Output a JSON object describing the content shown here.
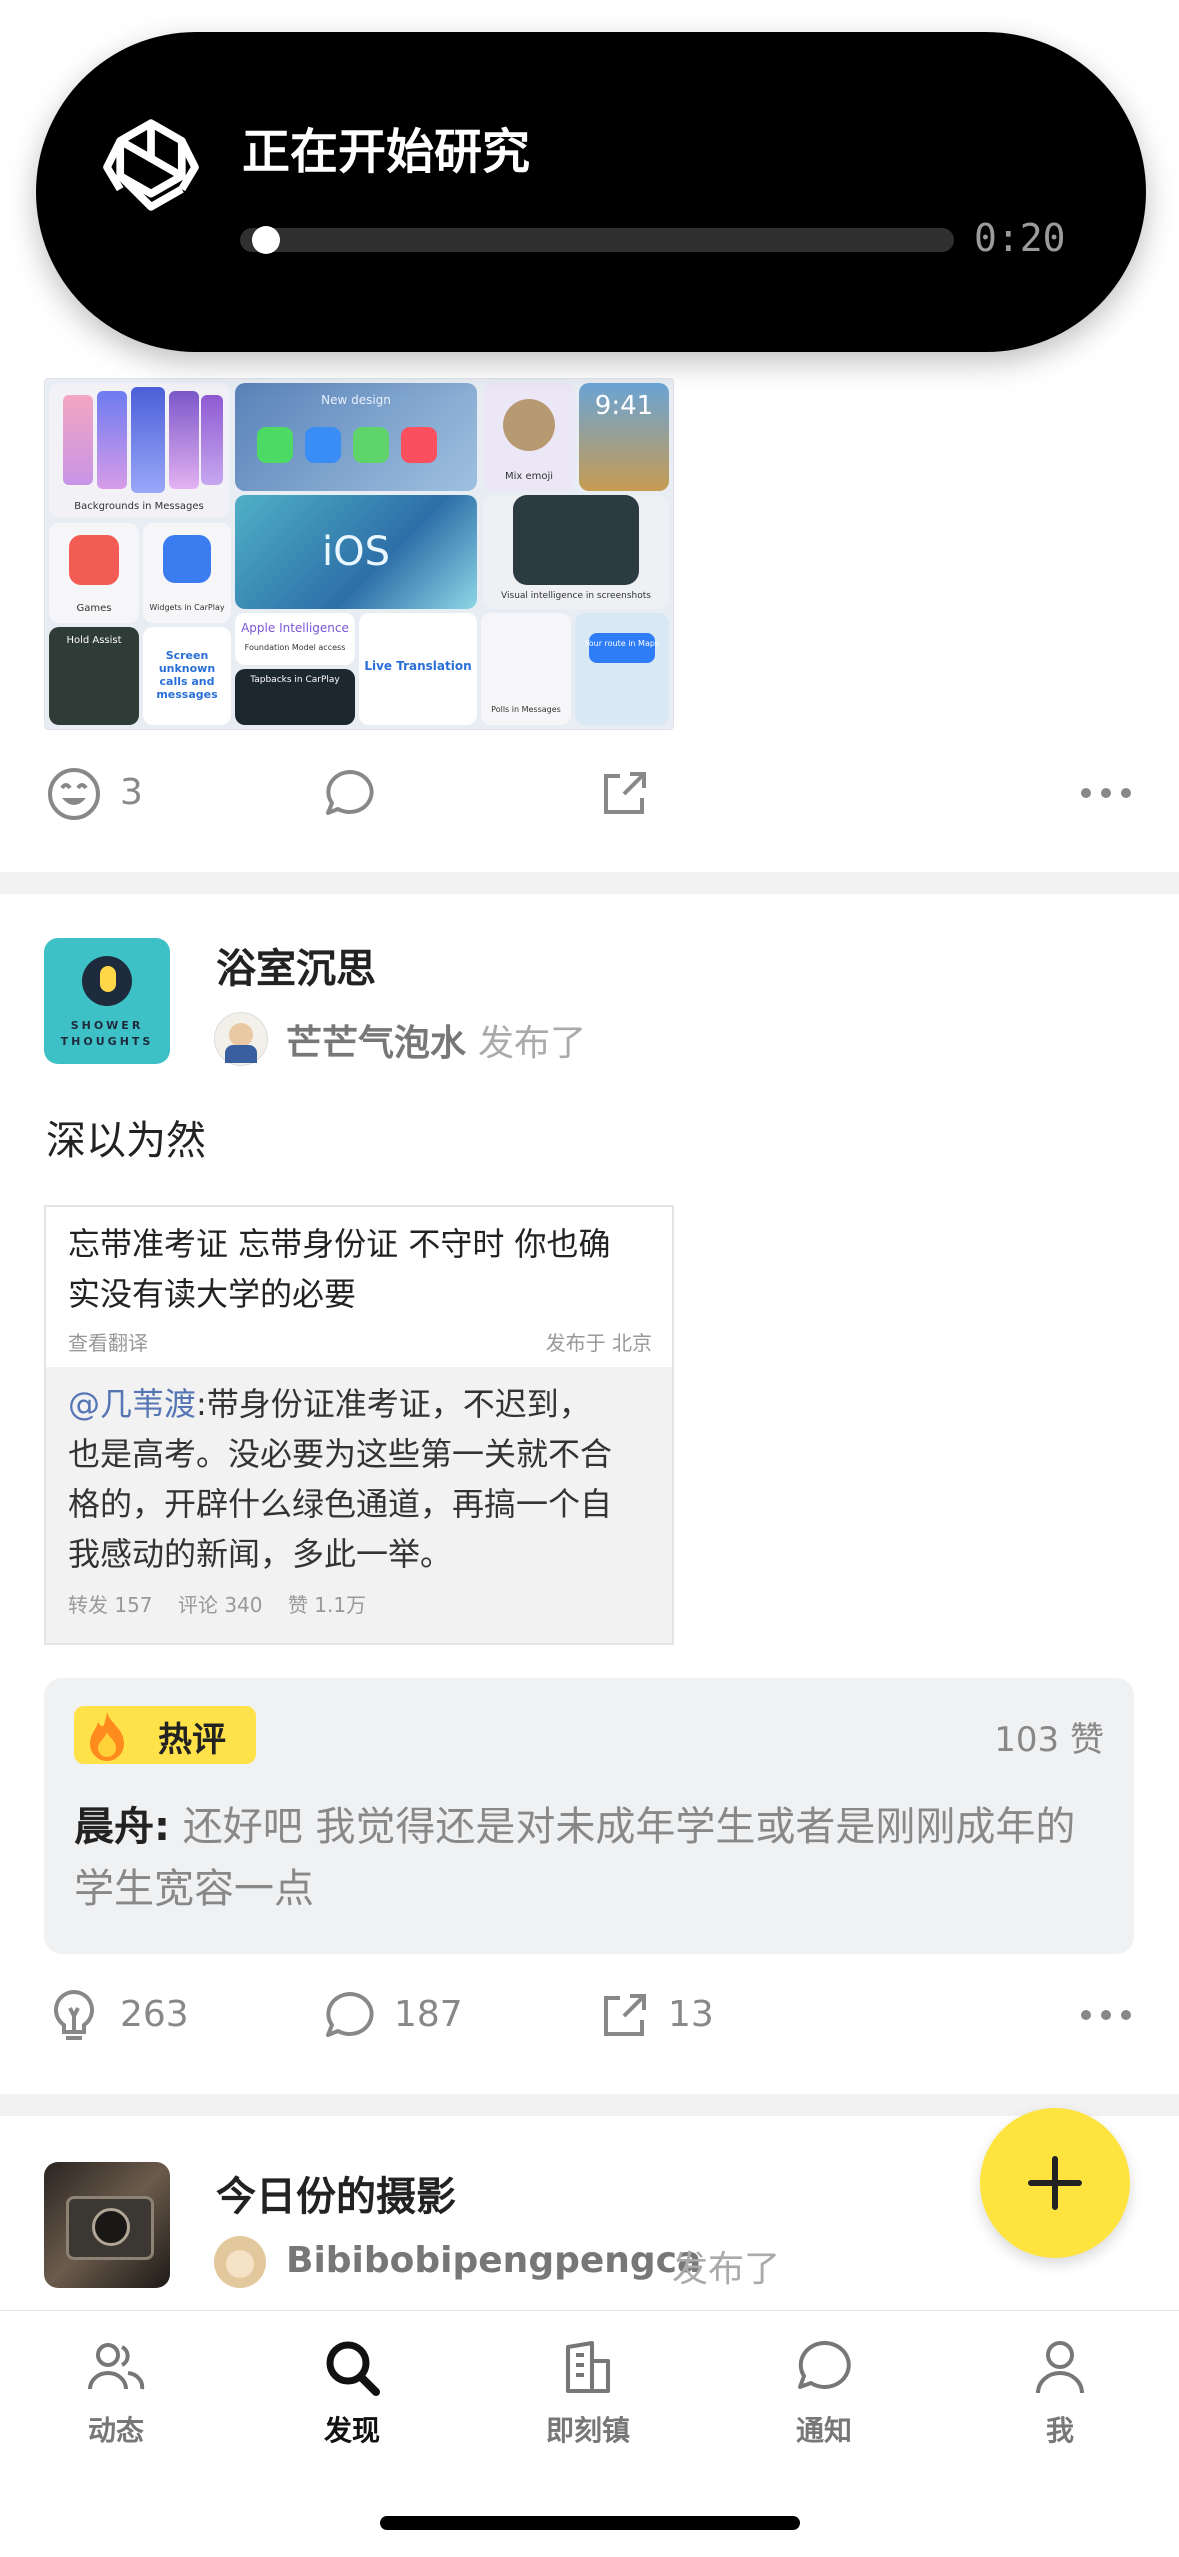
{
  "island": {
    "title": "正在开始研究",
    "time": "0:20",
    "progress": 0.02,
    "icon": "openai-logo-icon"
  },
  "collage": {
    "labels": {
      "backgrounds": "Backgrounds in Messages",
      "new_design": "New design",
      "mix_emoji": "Mix emoji",
      "time": "9:41",
      "ios": "iOS",
      "games": "Games",
      "widgets": "Widgets in CarPlay",
      "visual_intel": "Visual intelligence in screenshots",
      "hold_assist": "Hold Assist",
      "screen_calls": "Screen unknown calls and messages",
      "apple_intel": "Apple Intelligence",
      "foundation": "Foundation Model access",
      "tapbacks": "Tapbacks in CarPlay",
      "live_translation": "Live Translation",
      "polls": "Polls in Messages",
      "your_route": "Your route in Maps"
    }
  },
  "post1_actions": {
    "reaction_count": "3"
  },
  "post2": {
    "topic": "浴室沉思",
    "topic_avatar_text": "SHOWER THOUGHTS",
    "author": "芒芒气泡水",
    "published": "发布了",
    "text": "深以为然",
    "weibo": {
      "line1": "忘带准考证 忘带身份证 不守时 你也确",
      "line2": "实没有读大学的必要",
      "translate": "查看翻译",
      "location": "发布于 北京",
      "mention": "@几苇渡",
      "comment_line1": ":带身份证准考证，不迟到，",
      "comment_line2": "也是高考。没必要为这些第一关就不合",
      "comment_line3": "格的，开辟什么绿色通道，再搞一个自",
      "comment_line4": "我感动的新闻，多此一举。",
      "stats": "转发 157    评论 340    赞 1.1万"
    },
    "hot_comment": {
      "badge": "热评",
      "likes": "103 赞",
      "user": "晨舟:",
      "text": " 还好吧 我觉得还是对未成年学生或者是刚刚成年的学生宽容一点"
    },
    "actions": {
      "like_count": "263",
      "comment_count": "187",
      "share_count": "13"
    }
  },
  "post3": {
    "topic": "今日份的摄影",
    "author": "Bibibobipengpengca",
    "published": "发布了"
  },
  "tabbar": {
    "items": [
      {
        "label": "动态",
        "icon": "people-icon"
      },
      {
        "label": "发现",
        "icon": "search-icon"
      },
      {
        "label": "即刻镇",
        "icon": "building-icon"
      },
      {
        "label": "通知",
        "icon": "chat-bubble-icon"
      },
      {
        "label": "我",
        "icon": "person-icon"
      }
    ],
    "active_index": 1
  },
  "colors": {
    "accent": "#FFE33F",
    "hot_badge": "#FFE24A",
    "link": "#5575B4"
  }
}
